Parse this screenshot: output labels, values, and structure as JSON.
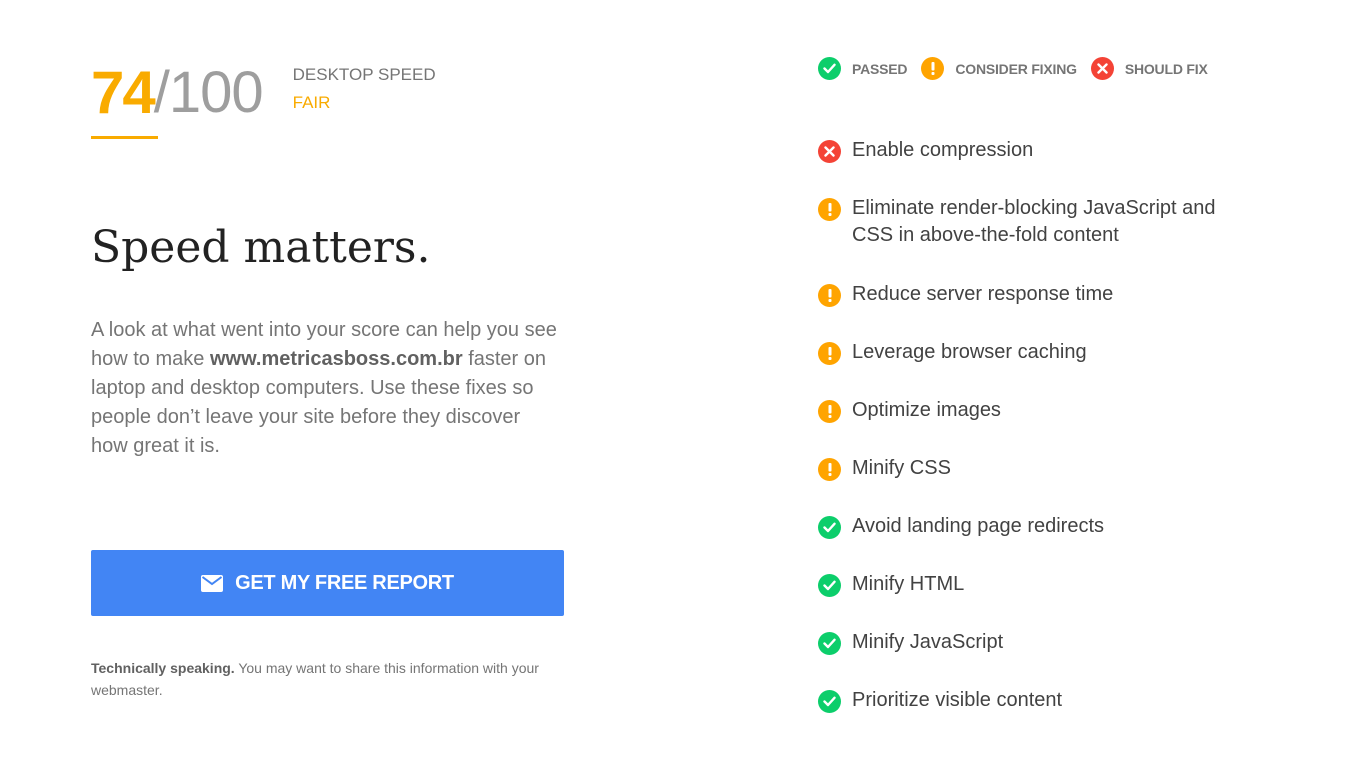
{
  "score": {
    "value": "74",
    "max": "/100",
    "label": "DESKTOP SPEED",
    "rating": "FAIR"
  },
  "headline": "Speed matters.",
  "description": {
    "part1": "A look at what went into your score can help you see how to make ",
    "site": "www.metricasboss.com.br",
    "part2": " faster on laptop and desktop computers. Use these fixes so people don’t leave your site before they discover how great it is."
  },
  "cta": {
    "label": "GET MY FREE REPORT",
    "icon": "mail-icon"
  },
  "footnote": {
    "bold": "Technically speaking.",
    "text": " You may want to share this information with your webmaster."
  },
  "legend": [
    {
      "status": "passed",
      "label": "PASSED"
    },
    {
      "status": "consider",
      "label": "CONSIDER FIXING"
    },
    {
      "status": "fix",
      "label": "SHOULD FIX"
    }
  ],
  "rules": [
    {
      "status": "fix",
      "label": "Enable compression"
    },
    {
      "status": "consider",
      "label": "Eliminate render-blocking JavaScript and CSS in above-the-fold content"
    },
    {
      "status": "consider",
      "label": "Reduce server response time"
    },
    {
      "status": "consider",
      "label": "Leverage browser caching"
    },
    {
      "status": "consider",
      "label": "Optimize images"
    },
    {
      "status": "consider",
      "label": "Minify CSS"
    },
    {
      "status": "passed",
      "label": "Avoid landing page redirects"
    },
    {
      "status": "passed",
      "label": "Minify HTML"
    },
    {
      "status": "passed",
      "label": "Minify JavaScript"
    },
    {
      "status": "passed",
      "label": "Prioritize visible content"
    }
  ],
  "colors": {
    "passed": "#0cce6b",
    "consider": "#ffa400",
    "fix": "#f44336",
    "accent": "#f9ab00",
    "button": "#4285f4"
  }
}
